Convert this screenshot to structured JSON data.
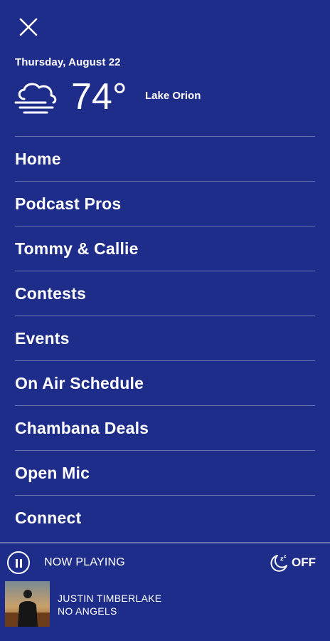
{
  "header": {
    "date": "Thursday, August 22",
    "weather": {
      "temperature": "74°",
      "location": "Lake Orion",
      "icon": "cloud-fog-icon"
    }
  },
  "menu": {
    "items": [
      {
        "label": "Home"
      },
      {
        "label": "Podcast Pros"
      },
      {
        "label": "Tommy & Callie"
      },
      {
        "label": "Contests"
      },
      {
        "label": "Events"
      },
      {
        "label": "On Air Schedule"
      },
      {
        "label": "Chambana Deals"
      },
      {
        "label": "Open Mic"
      },
      {
        "label": "Connect"
      }
    ]
  },
  "player": {
    "status_label": "NOW PLAYING",
    "sleep_timer": "OFF",
    "artist": "JUSTIN TIMBERLAKE",
    "song": "NO ANGELS"
  },
  "colors": {
    "background": "#1f2d8a",
    "text": "#ffffff"
  }
}
